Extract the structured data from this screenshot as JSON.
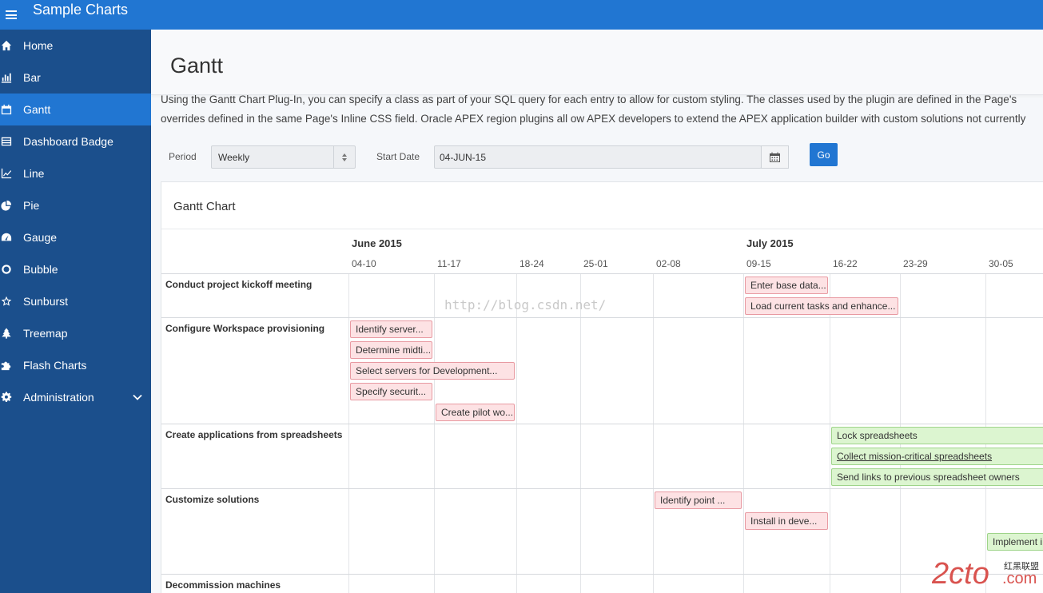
{
  "app": {
    "title": "Sample Charts"
  },
  "sidebar": {
    "items": [
      {
        "label": "Home",
        "icon": "home-icon"
      },
      {
        "label": "Bar",
        "icon": "bar-chart-icon"
      },
      {
        "label": "Gantt",
        "icon": "calendar-icon",
        "active": true
      },
      {
        "label": "Dashboard Badge",
        "icon": "list-icon"
      },
      {
        "label": "Line",
        "icon": "line-chart-icon"
      },
      {
        "label": "Pie",
        "icon": "pie-chart-icon"
      },
      {
        "label": "Gauge",
        "icon": "gauge-icon"
      },
      {
        "label": "Bubble",
        "icon": "circle-icon"
      },
      {
        "label": "Sunburst",
        "icon": "star-icon"
      },
      {
        "label": "Treemap",
        "icon": "tree-icon"
      },
      {
        "label": "Flash Charts",
        "icon": "puzzle-icon"
      },
      {
        "label": "Administration",
        "icon": "gear-icon"
      }
    ]
  },
  "page": {
    "title": "Gantt",
    "description_line1": "Using the Gantt Chart Plug-In, you can specify a class as part of your SQL query for each entry to allow for custom styling. The classes used by the plugin are defined in the Page's",
    "description_line2": "overrides defined in the same Page's Inline CSS field. Oracle APEX region plugins all ow APEX developers to extend the APEX application builder with custom solutions not currently"
  },
  "filters": {
    "period_label": "Period",
    "period_value": "Weekly",
    "start_date_label": "Start Date",
    "start_date_value": "04-JUN-15",
    "go_label": "Go"
  },
  "region": {
    "title": "Gantt Chart"
  },
  "gantt": {
    "months": [
      "June 2015",
      "July 2015"
    ],
    "weeks": [
      "04-10",
      "11-17",
      "18-24",
      "25-01",
      "02-08",
      "09-15",
      "16-22",
      "23-29",
      "30-05"
    ],
    "rows": [
      {
        "label": "Conduct project kickoff meeting"
      },
      {
        "label": "Configure Workspace provisioning"
      },
      {
        "label": "Create applications from spreadsheets"
      },
      {
        "label": "Customize solutions"
      },
      {
        "label": "Decommission machines"
      }
    ],
    "tasks": [
      {
        "label": "Enter base data..."
      },
      {
        "label": "Load current tasks and enhance..."
      },
      {
        "label": "Identify server..."
      },
      {
        "label": "Determine midti..."
      },
      {
        "label": "Select servers for Development..."
      },
      {
        "label": "Specify securit..."
      },
      {
        "label": "Create pilot wo..."
      },
      {
        "label": "Lock spreadsheets"
      },
      {
        "label": "Collect mission-critical spreadsheets"
      },
      {
        "label": "Send links to previous spreadsheet owners"
      },
      {
        "label": "Identify point ..."
      },
      {
        "label": "Install in deve..."
      },
      {
        "label": "Implement i"
      }
    ]
  },
  "watermark": {
    "url": "http://blog.csdn.net/",
    "logo_text": "2cto",
    "logo_suffix": ".com",
    "logo_cn": "红黑联盟"
  },
  "colors": {
    "accent": "#2176d2",
    "sidebar": "#1b4f8c",
    "task_red": "#fde2e4",
    "task_green": "#dcf5d0"
  }
}
